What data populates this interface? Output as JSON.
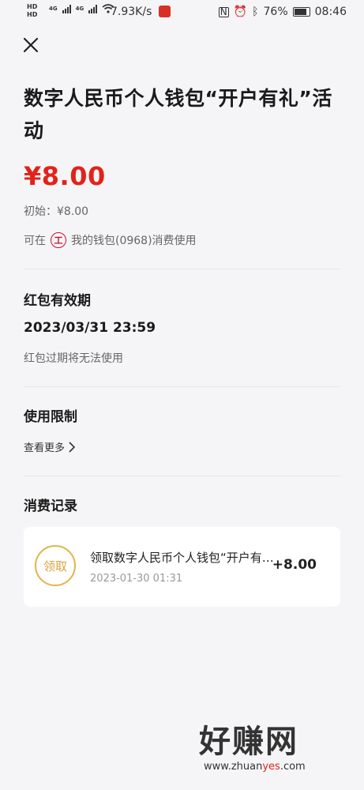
{
  "status_bar": {
    "net_speed": "7.93K/s",
    "battery": "76%",
    "time": "08:46",
    "network": "4G"
  },
  "header": {
    "title": "数字人民币个人钱包“开户有礼”活动"
  },
  "red_packet": {
    "amount": "¥8.00",
    "initial": "初始：¥8.00",
    "usable_prefix": "可在",
    "wallet": "我的钱包(0968)消费使用",
    "bank_icon_text": "工"
  },
  "validity": {
    "title": "红包有效期",
    "date": "2023/03/31 23:59",
    "note": "红包过期将无法使用"
  },
  "restriction": {
    "title": "使用限制",
    "more": "查看更多"
  },
  "records": {
    "title": "消费记录",
    "items": [
      {
        "badge": "领取",
        "title": "领取数字人民币个人钱包“开户有礼”活动",
        "time": "2023-01-30 01:31",
        "amount": "+8.00"
      }
    ]
  },
  "watermark": {
    "brand": "好赚网",
    "url_prefix": "www.zhuan",
    "url_highlight": "yes",
    "url_suffix": ".com"
  },
  "colors": {
    "accent": "#e2231a",
    "badge": "#d9a441",
    "background": "#f5f5f7"
  }
}
